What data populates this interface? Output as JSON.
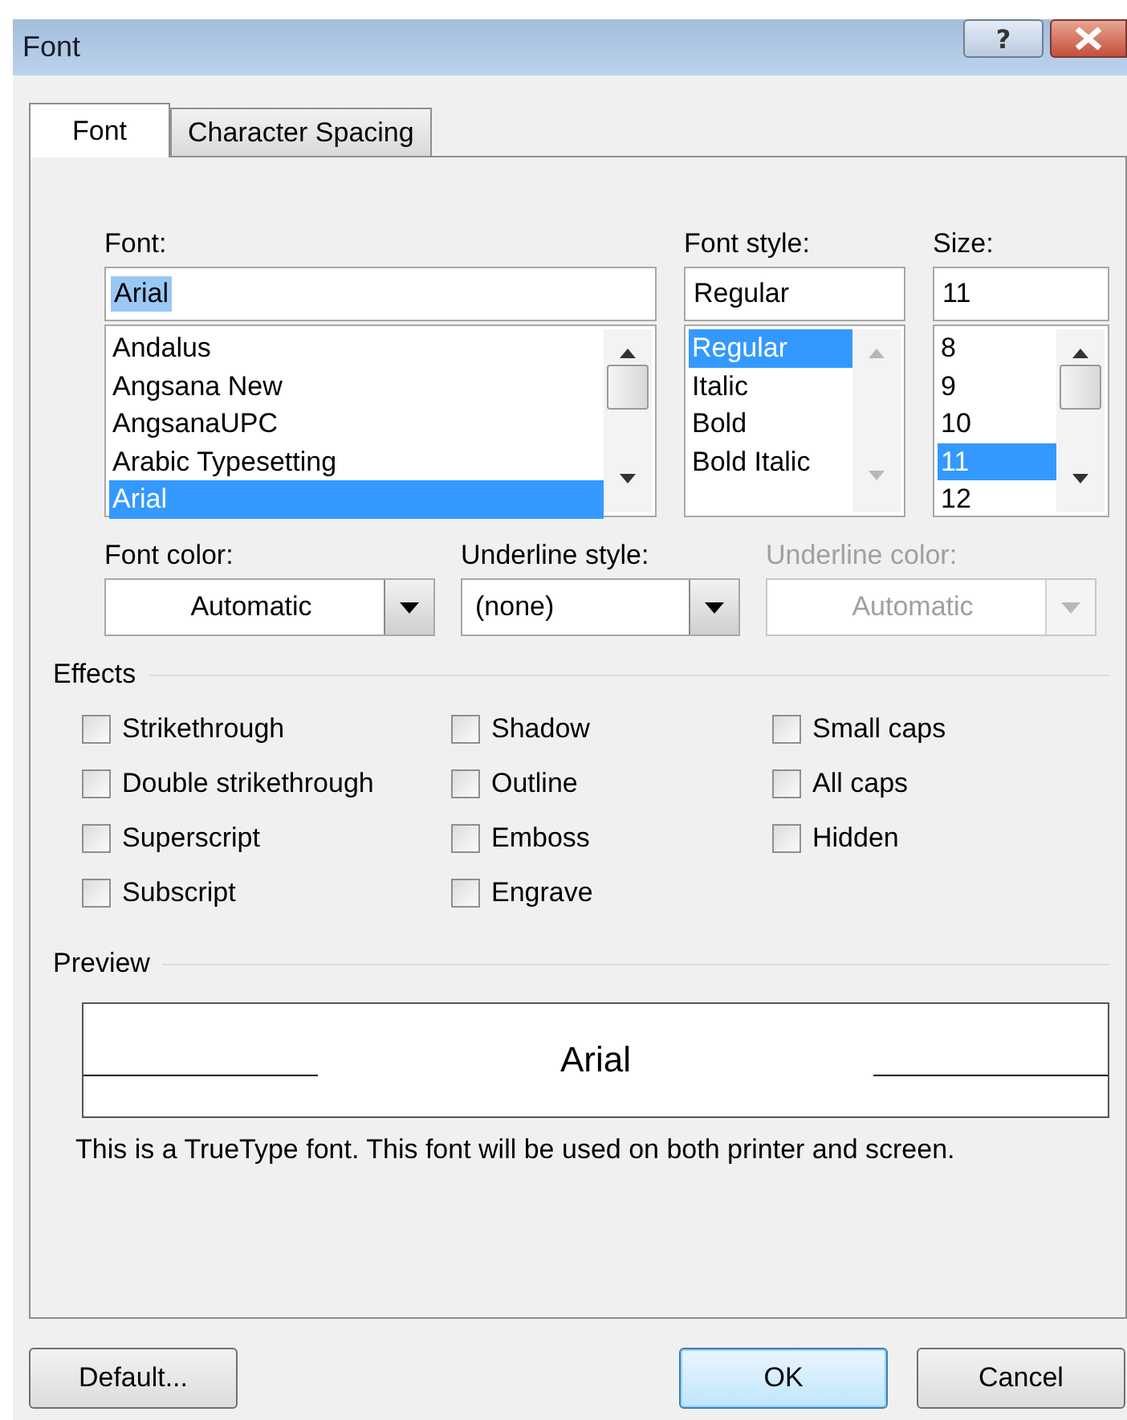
{
  "window": {
    "title": "Font",
    "help_button": "?"
  },
  "tabs": [
    {
      "label": "Font",
      "selected": true
    },
    {
      "label": "Character Spacing",
      "selected": false
    }
  ],
  "font": {
    "label": "Font:",
    "value": "Arial",
    "value_selected": true,
    "scrollable": true,
    "items": [
      {
        "label": "Andalus",
        "selected": false
      },
      {
        "label": "Angsana New",
        "selected": false
      },
      {
        "label": "AngsanaUPC",
        "selected": false
      },
      {
        "label": "Arabic Typesetting",
        "selected": false
      },
      {
        "label": "Arial",
        "selected": true
      }
    ]
  },
  "font_style": {
    "label": "Font style:",
    "value": "Regular",
    "value_selected": false,
    "scrollable": false,
    "items": [
      {
        "label": "Regular",
        "selected": true
      },
      {
        "label": "Italic",
        "selected": false
      },
      {
        "label": "Bold",
        "selected": false
      },
      {
        "label": "Bold Italic",
        "selected": false
      }
    ]
  },
  "size": {
    "label": "Size:",
    "value": "11",
    "value_selected": false,
    "scrollable": true,
    "items": [
      {
        "label": "8",
        "selected": false
      },
      {
        "label": "9",
        "selected": false
      },
      {
        "label": "10",
        "selected": false
      },
      {
        "label": "11",
        "selected": true
      },
      {
        "label": "12",
        "selected": false
      }
    ]
  },
  "dropdowns": [
    {
      "label": "Font color:",
      "value": "Automatic",
      "centered": true,
      "disabled": false
    },
    {
      "label": "Underline style:",
      "value": "(none)",
      "centered": false,
      "disabled": false
    },
    {
      "label": "Underline color:",
      "value": "Automatic",
      "centered": true,
      "disabled": true
    }
  ],
  "effects": {
    "title": "Effects",
    "columns": [
      [
        {
          "label": "Strikethrough",
          "checked": false
        },
        {
          "label": "Double strikethrough",
          "checked": false
        },
        {
          "label": "Superscript",
          "checked": false
        },
        {
          "label": "Subscript",
          "checked": false
        }
      ],
      [
        {
          "label": "Shadow",
          "checked": false
        },
        {
          "label": "Outline",
          "checked": false
        },
        {
          "label": "Emboss",
          "checked": false
        },
        {
          "label": "Engrave",
          "checked": false
        }
      ],
      [
        {
          "label": "Small caps",
          "checked": false
        },
        {
          "label": "All caps",
          "checked": false
        },
        {
          "label": "Hidden",
          "checked": false
        }
      ]
    ]
  },
  "preview": {
    "title": "Preview",
    "sample": "Arial",
    "note": "This is a TrueType font. This font will be used on both printer and screen."
  },
  "buttons": [
    {
      "label": "Default...",
      "default": false
    },
    {
      "label": "OK",
      "default": true
    },
    {
      "label": "Cancel",
      "default": false
    }
  ]
}
